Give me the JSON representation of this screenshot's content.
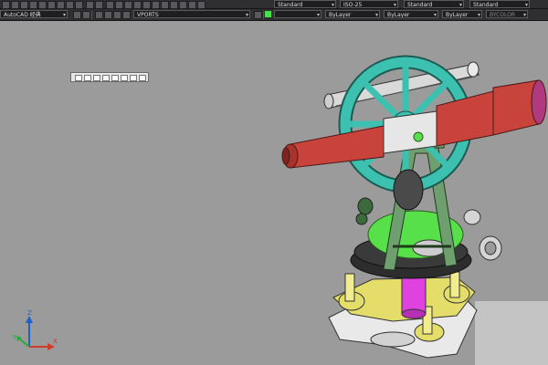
{
  "toolbar_top": {
    "dropdowns": [
      {
        "value": ""
      },
      {
        "value": "Standard"
      },
      {
        "value": "ISO-25"
      },
      {
        "value": "Standard"
      },
      {
        "value": "Standard"
      }
    ]
  },
  "toolbar_bottom": {
    "workspace_value": "AutoCAD 经典",
    "viewports_value": "VPORTS",
    "layer_value": "",
    "color_value": "ByLayer",
    "linetype_value": "ByLayer",
    "lineweight_value": "ByLayer",
    "plotstyle_value": "BYCOLOR"
  },
  "ucs": {
    "x_label": "X",
    "y_label": "Y",
    "z_label": "Z"
  },
  "colors": {
    "toolbar_bg": "#2f2f31",
    "viewport_bg": "#9b9b9b",
    "telescope": "#c8433b",
    "wheel": "#3cc0b0",
    "frame": "#6f9e6f",
    "base_disk": "#57e04a",
    "tripod": "#e4dd6a",
    "column": "#e042e0"
  },
  "icons": [
    "save-icon",
    "open-icon",
    "print-icon",
    "undo-icon",
    "redo-icon",
    "layer-properties-icon",
    "ucs-icon",
    "lightbulb-icon",
    "sun-icon",
    "lock-icon"
  ]
}
